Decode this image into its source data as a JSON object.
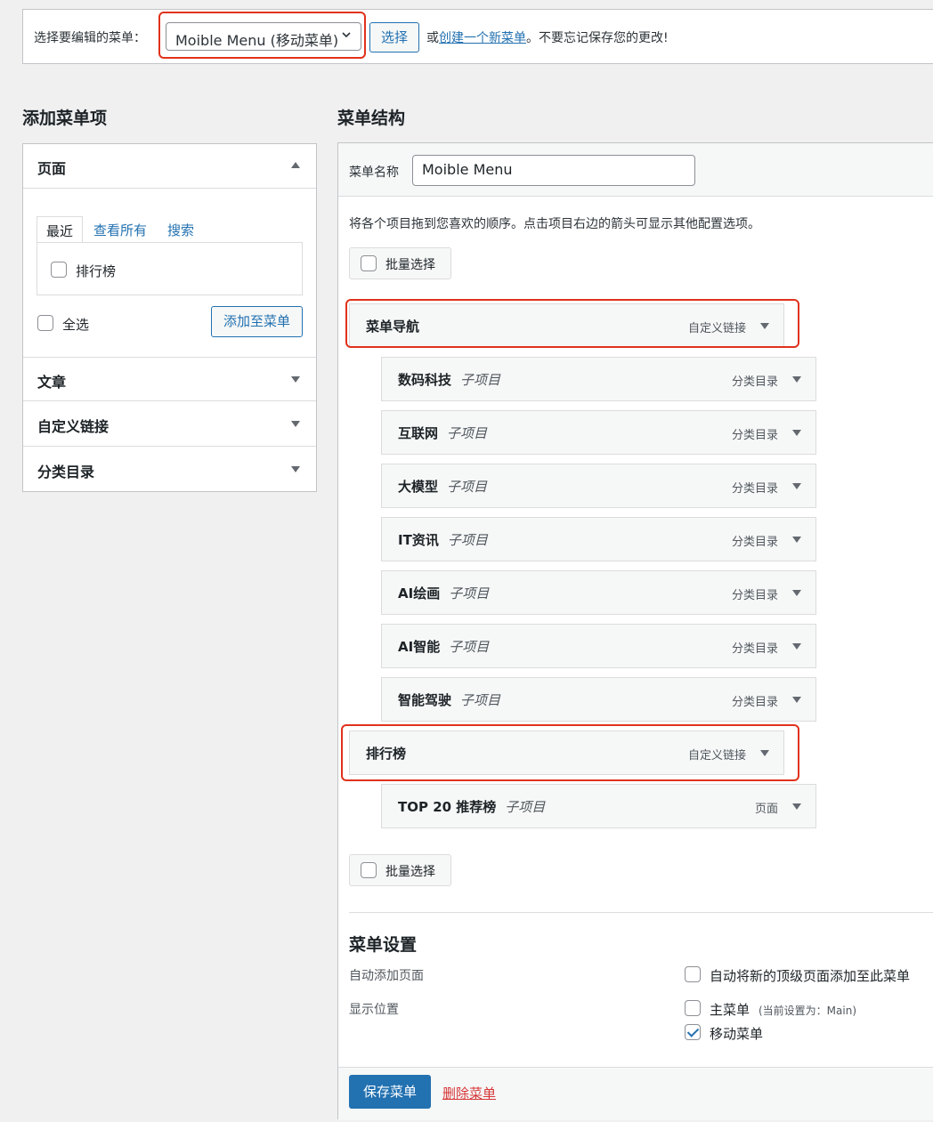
{
  "topbar": {
    "label": "选择要编辑的菜单：",
    "menu_select_value": "Moible Menu (移动菜单)",
    "select_button": "选择",
    "or_text": "或",
    "create_link": "创建一个新菜单",
    "reminder": "。不要忘记保存您的更改!"
  },
  "left": {
    "heading": "添加菜单项",
    "pages": {
      "title": "页面",
      "tabs": [
        "最近",
        "查看所有",
        "搜索"
      ],
      "items": [
        "排行榜"
      ],
      "select_all": "全选",
      "add_button": "添加至菜单"
    },
    "sections": [
      "文章",
      "自定义链接",
      "分类目录"
    ]
  },
  "main": {
    "heading": "菜单结构",
    "menu_name_label": "菜单名称",
    "menu_name_value": "Moible Menu",
    "instructions": "将各个项目拖到您喜欢的顺序。点击项目右边的箭头可显示其他配置选项。",
    "bulk_select": "批量选择",
    "items": [
      {
        "title": "菜单导航",
        "sub": "",
        "type": "自定义链接"
      },
      {
        "title": "数码科技",
        "sub": "子项目",
        "type": "分类目录"
      },
      {
        "title": "互联网",
        "sub": "子项目",
        "type": "分类目录"
      },
      {
        "title": "大模型",
        "sub": "子项目",
        "type": "分类目录"
      },
      {
        "title": "IT资讯",
        "sub": "子项目",
        "type": "分类目录"
      },
      {
        "title": "AI绘画",
        "sub": "子项目",
        "type": "分类目录"
      },
      {
        "title": "AI智能",
        "sub": "子项目",
        "type": "分类目录"
      },
      {
        "title": "智能驾驶",
        "sub": "子项目",
        "type": "分类目录"
      },
      {
        "title": "排行榜",
        "sub": "",
        "type": "自定义链接"
      },
      {
        "title": "TOP 20 推荐榜",
        "sub": "子项目",
        "type": "页面"
      }
    ],
    "settings": {
      "heading": "菜单设置",
      "auto_add_label": "自动添加页面",
      "auto_add_option": "自动将新的顶级页面添加至此菜单",
      "location_label": "显示位置",
      "main_menu": "主菜单",
      "main_menu_note": "(当前设置为：Main)",
      "mobile_menu": "移动菜单",
      "mobile_menu_checked": true
    },
    "save_button": "保存菜单",
    "delete_link": "删除菜单"
  },
  "colors": {
    "accent": "#2271b1",
    "highlight": "#e0321c"
  }
}
